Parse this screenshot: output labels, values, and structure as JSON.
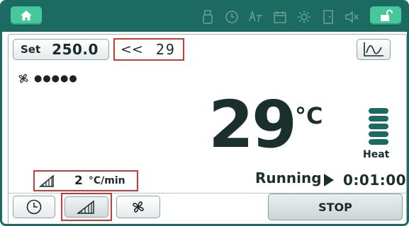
{
  "setpoint": {
    "label": "Set",
    "value": "250.0"
  },
  "ramp_target": {
    "arrows": "<<",
    "value": "29"
  },
  "fan": {
    "speed_dots": "●●●●●"
  },
  "temperature": {
    "value": "29",
    "unit": "°C"
  },
  "heat": {
    "label": "Heat",
    "bars": 5
  },
  "ramp_rate": {
    "value": "2",
    "unit": "°C/min"
  },
  "status": {
    "text": "Running",
    "time": "0:01:00"
  },
  "buttons": {
    "stop": "STOP"
  },
  "colors": {
    "accent": "#1c6b62",
    "button_green": "#46c89a",
    "highlight": "#c93a3a"
  }
}
